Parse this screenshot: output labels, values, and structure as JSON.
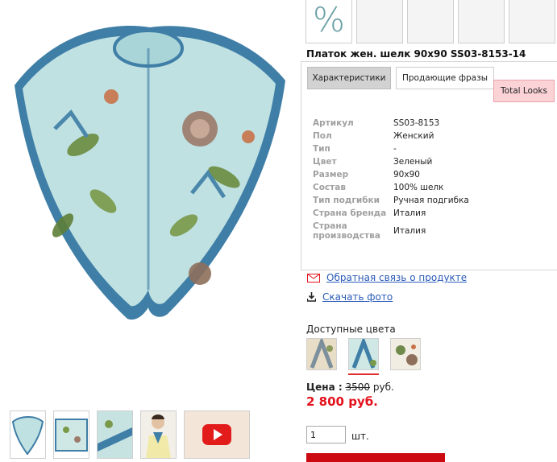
{
  "promo": {
    "percent_symbol": "%"
  },
  "product": {
    "title": "Платок жен. шелк 90х90 SS03-8153-14"
  },
  "tabs": [
    {
      "label": "Характеристики",
      "active": true
    },
    {
      "label": "Продающие фразы",
      "active": false
    },
    {
      "label": "Total Looks",
      "active": false
    }
  ],
  "specs": [
    {
      "key": "Артикул",
      "value": "SS03-8153"
    },
    {
      "key": "Пол",
      "value": "Женский"
    },
    {
      "key": "Тип",
      "value": "-"
    },
    {
      "key": "Цвет",
      "value": "Зеленый"
    },
    {
      "key": "Размер",
      "value": "90х90"
    },
    {
      "key": "Состав",
      "value": "100% шелк"
    },
    {
      "key": "Тип подгибки",
      "value": "Ручная подгибка"
    },
    {
      "key": "Страна бренда",
      "value": "Италия"
    },
    {
      "key": "Страна производства",
      "value": "Италия"
    }
  ],
  "links": {
    "feedback": "Обратная связь о продукте",
    "download": "Скачать фото"
  },
  "colors": {
    "label": "Доступные цвета",
    "selected_index": 1
  },
  "price": {
    "label": "Цена :",
    "old": "3500",
    "old_unit": "руб.",
    "new": "2 800 руб."
  },
  "quantity": {
    "value": "1",
    "unit": "шт."
  },
  "theme": {
    "accent_red": "#e3111b",
    "link_blue": "#2a5bb8",
    "cart_red": "#cc0a12"
  }
}
